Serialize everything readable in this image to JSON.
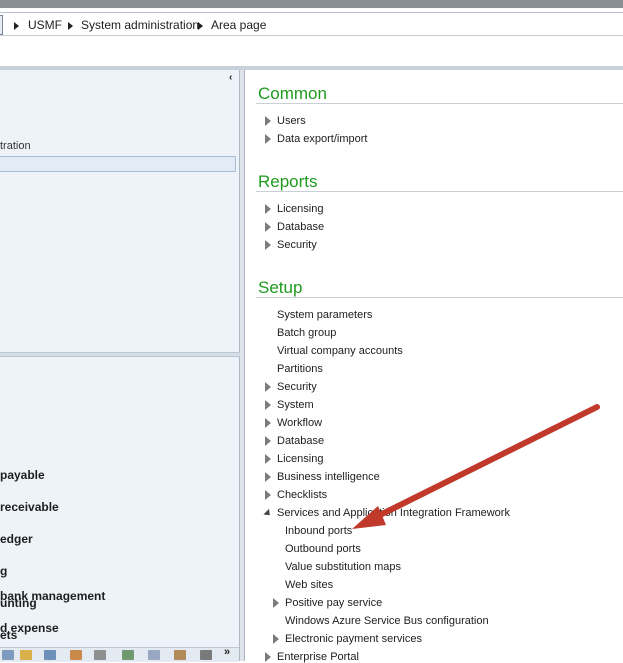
{
  "breadcrumb": {
    "items": [
      "USMF",
      "System administration",
      "Area page"
    ]
  },
  "nav": {
    "collapse_symbol": "‹",
    "section_label": "tration",
    "modules": [
      {
        "label": "payable"
      },
      {
        "label": "receivable"
      },
      {
        "label": "edger"
      },
      {
        "label": "g"
      },
      {
        "label": "unting"
      },
      {
        "label": "ets"
      },
      {
        "label": "bank management"
      },
      {
        "label": "d expense"
      }
    ],
    "more_symbol": "»"
  },
  "content": {
    "common": {
      "title": "Common",
      "items": [
        "Users",
        "Data export/import"
      ]
    },
    "reports": {
      "title": "Reports",
      "items": [
        "Licensing",
        "Database",
        "Security"
      ]
    },
    "setup": {
      "title": "Setup",
      "items": [
        "System parameters",
        "Batch group",
        "Virtual company accounts",
        "Partitions",
        "Security",
        "System",
        "Workflow",
        "Database",
        "Licensing",
        "Business intelligence",
        "Checklists",
        "Services and Application Integration Framework",
        "Inbound ports",
        "Outbound ports",
        "Value substitution maps",
        "Web sites",
        "Positive pay service",
        "Windows Azure Service Bus configuration",
        "Electronic payment services",
        "Enterprise Portal"
      ]
    }
  },
  "annotation_color": "#c0392b"
}
